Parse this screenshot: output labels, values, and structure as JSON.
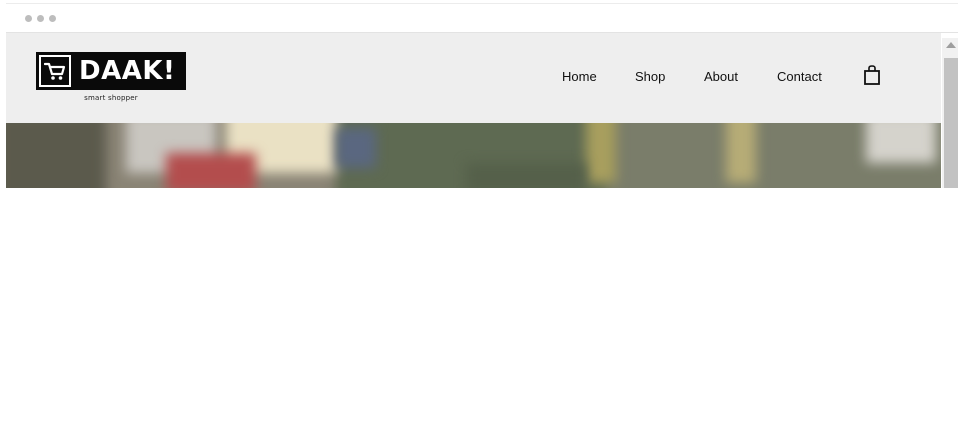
{
  "window": {
    "controls": [
      "dot",
      "dot",
      "dot"
    ]
  },
  "brand": {
    "name": "DAAK!",
    "tagline": "smart shopper",
    "icon": "shopping-cart-icon"
  },
  "nav": {
    "items": [
      {
        "label": "Home"
      },
      {
        "label": "Shop"
      },
      {
        "label": "About"
      },
      {
        "label": "Contact"
      }
    ],
    "cart_icon": "shopping-bag-icon"
  },
  "colors": {
    "header_bg": "#eeeeee",
    "logo_bg": "#0a0a0a",
    "logo_fg": "#ffffff",
    "nav_text": "#111111"
  }
}
